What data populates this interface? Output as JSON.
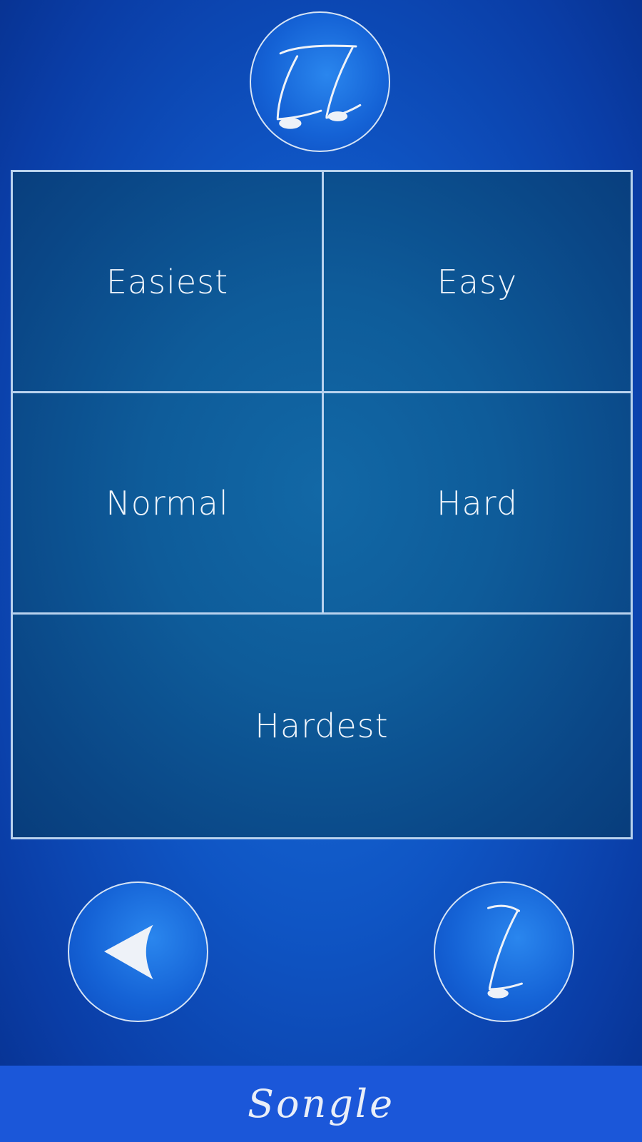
{
  "header": {
    "logo_icon": "double-music-note-icon"
  },
  "difficulty": {
    "options": [
      {
        "label": "Easiest"
      },
      {
        "label": "Easy"
      },
      {
        "label": "Normal"
      },
      {
        "label": "Hard"
      },
      {
        "label": "Hardest"
      }
    ]
  },
  "controls": {
    "back_icon": "back-arrow-icon",
    "help_icon": "question-mark-icon"
  },
  "footer": {
    "title": "Songle"
  },
  "colors": {
    "background": "#0f55c4",
    "grid_fill": "#0e5c9a",
    "grid_border": "#b9d2ee",
    "footer_bar": "#1b57d9",
    "text": "#eef4fb"
  }
}
